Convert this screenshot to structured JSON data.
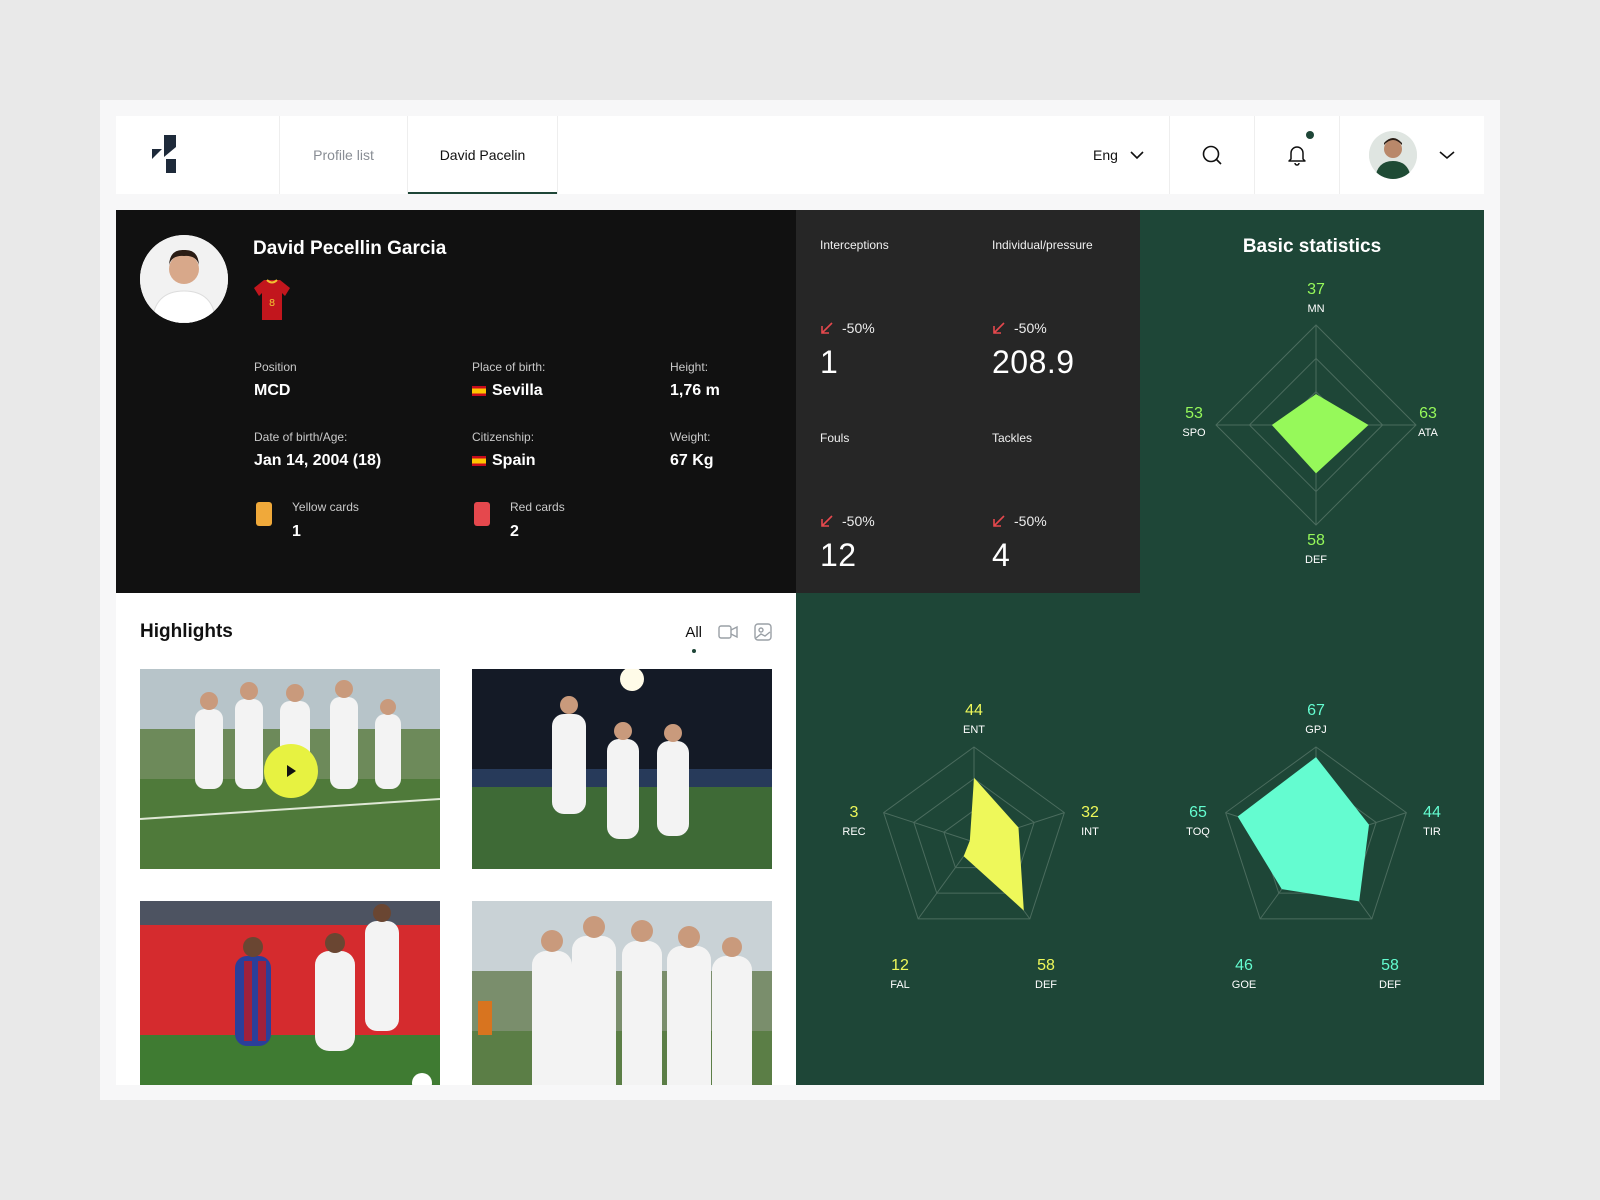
{
  "header": {
    "tabs": [
      {
        "label": "Profile list",
        "active": false
      },
      {
        "label": "David Pacelin",
        "active": true
      }
    ],
    "language": "Eng",
    "icons": {
      "logo": "brand-logo-icon",
      "search": "search-icon",
      "notifications": "bell-icon",
      "dropdown": "chevron-down-icon"
    }
  },
  "profile": {
    "name": "David Pecellin Garcia",
    "jersey_number": "8",
    "position_label": "Position",
    "position": "MCD",
    "birthplace_label": "Place of birth:",
    "birthplace": "Sevilla",
    "height_label": "Height:",
    "height": "1,76 m",
    "dob_label": "Date of birth/Age:",
    "dob": "Jan 14, 2004 (18)",
    "citizenship_label": "Citizenship:",
    "citizenship": "Spain",
    "weight_label": "Weight:",
    "weight": "67 Kg",
    "yellow_label": "Yellow cards",
    "yellow": "1",
    "red_label": "Red cards",
    "red": "2"
  },
  "stats": [
    {
      "label": "Interceptions",
      "change": "-50%",
      "value": "1"
    },
    {
      "label": "Individual/pressure",
      "change": "-50%",
      "value": "208.9"
    },
    {
      "label": "Fouls",
      "change": "-50%",
      "value": "12"
    },
    {
      "label": "Tackles",
      "change": "-50%",
      "value": "4"
    }
  ],
  "radar": {
    "title": "Basic statistics",
    "basic": {
      "color": "#96f95a",
      "axes": [
        {
          "label": "MN",
          "value": 37
        },
        {
          "label": "ATA",
          "value": 63
        },
        {
          "label": "DEF",
          "value": 58
        },
        {
          "label": "SPO",
          "value": 53
        }
      ]
    },
    "defense": {
      "color": "#eef85a",
      "axes": [
        {
          "label": "ENT",
          "value": 44
        },
        {
          "label": "INT",
          "value": 32
        },
        {
          "label": "DEF",
          "value": 58
        },
        {
          "label": "FAL",
          "value": 12
        },
        {
          "label": "REC",
          "value": 3
        }
      ]
    },
    "attack": {
      "color": "#64fcd0",
      "axes": [
        {
          "label": "GPJ",
          "value": 67
        },
        {
          "label": "TIR",
          "value": 44
        },
        {
          "label": "DEF",
          "value": 58
        },
        {
          "label": "GOE",
          "value": 46
        },
        {
          "label": "TOQ",
          "value": 65
        }
      ]
    }
  },
  "highlights": {
    "title": "Highlights",
    "filter_all": "All"
  },
  "colors": {
    "green": "#1e4637",
    "dark": "#111111",
    "yellow_card": "#f0a93a",
    "red_card": "#e5484d",
    "down_arrow": "#e5484d"
  }
}
